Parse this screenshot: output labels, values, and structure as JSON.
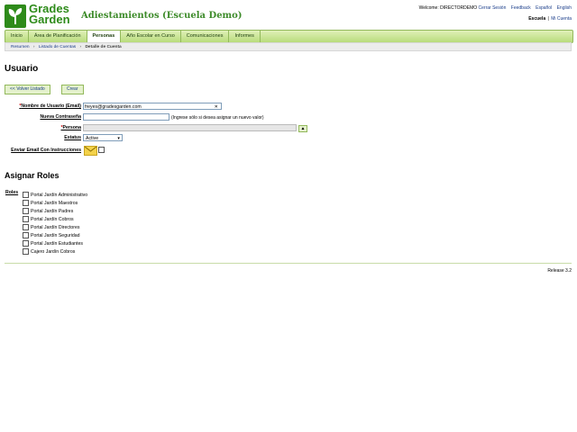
{
  "logo": {
    "line1": "Grades",
    "line2": "Garden"
  },
  "school_title": "Adiestamientos (Escuela Demo)",
  "top_links": {
    "welcome": "Welcome: DIRECTORDEMO",
    "logout": "Cerrar Sesión",
    "feedback": "Feedback",
    "spanish": "Español",
    "english": "English"
  },
  "context": {
    "school": "Escuela",
    "sep": "|",
    "my_school": "Mi Cuenta"
  },
  "nav": {
    "tabs": [
      "Inicio",
      "Área de Planificación",
      "Personas",
      "Año Escolar en Curso",
      "Comunicaciones",
      "Informes"
    ],
    "active": "Personas"
  },
  "breadcrumb": {
    "items": [
      "Resumen",
      "Listado de Cuentas",
      "Detalle de Cuenta"
    ],
    "sep": "›"
  },
  "page_title": "Usuario",
  "buttons": {
    "back": "<< Volver Listado",
    "create": "Crear"
  },
  "form": {
    "username_label": "Nombre de Usuario (Email)",
    "username_value": "freyes@gradesgarden.com",
    "password_label": "Nueva Contraseña",
    "password_hint": "(Ingrese sólo si desea asignar un nuevo valor)",
    "person_label": "Persona",
    "person_value": "",
    "status_label": "Estatus",
    "status_value": "Active",
    "send_email_label": "Enviar Email Con Instrucciones",
    "required_mark": "*"
  },
  "roles_section_title": "Asignar Roles",
  "roles_label": "Roles",
  "roles": [
    "Portal Jardín Administrativo",
    "Portal Jardín Maestros",
    "Portal Jardín Padres",
    "Portal Jardín Cobros",
    "Portal Jardín Directores",
    "Portal Jardín Seguridad",
    "Portal Jardín Estudiantes",
    "Cajero Jardín Cobros"
  ],
  "footer": {
    "release": "Release 3.2"
  },
  "colors": {
    "brand_green": "#2e8b1a",
    "nav_green": "#b8dc7c",
    "required_red": "#cc0000"
  }
}
